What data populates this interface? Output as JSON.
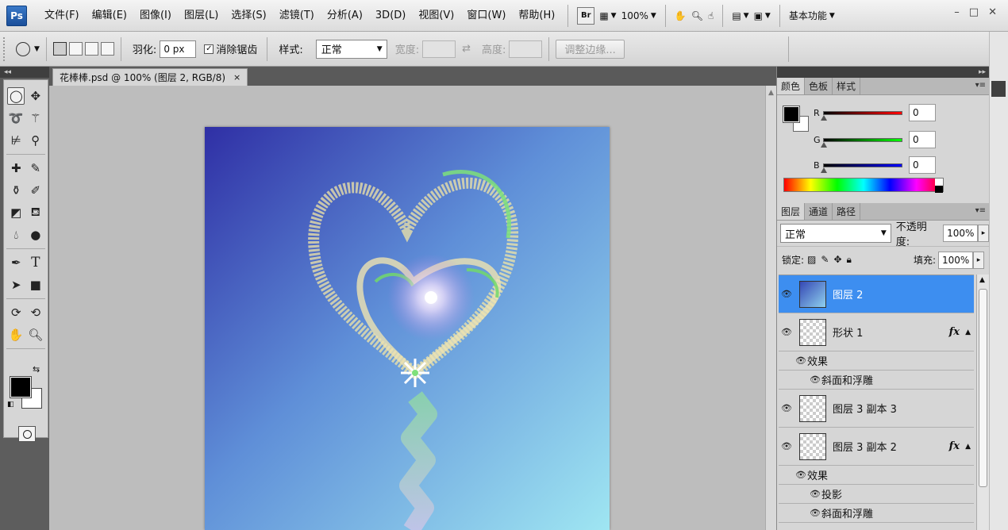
{
  "app": {
    "logo": "Ps",
    "menus": [
      "文件(F)",
      "编辑(E)",
      "图像(I)",
      "图层(L)",
      "选择(S)",
      "滤镜(T)",
      "分析(A)",
      "3D(D)",
      "视图(V)",
      "窗口(W)",
      "帮助(H)"
    ],
    "bridge_label": "Br",
    "zoom": "100%",
    "workspace": "基本功能",
    "window_controls": [
      "–",
      "□",
      "✕"
    ]
  },
  "options": {
    "feather_label": "羽化:",
    "feather_value": "0 px",
    "antialias_label": "消除锯齿",
    "antialias_checked": true,
    "style_label": "样式:",
    "style_value": "正常",
    "width_label": "宽度:",
    "height_label": "高度:",
    "refine_edge_button": "调整边缘..."
  },
  "document": {
    "tab_title": "花棒棒.psd @ 100% (图层 2, RGB/8)",
    "close_glyph": "×"
  },
  "color_panel": {
    "tabs": [
      "颜色",
      "色板",
      "样式"
    ],
    "active_tab": "颜色",
    "channels": [
      {
        "name": "R",
        "value": "0",
        "color": "#ff0000"
      },
      {
        "name": "G",
        "value": "0",
        "color": "#00ff00"
      },
      {
        "name": "B",
        "value": "0",
        "color": "#0000ff"
      }
    ],
    "foreground": "#000000",
    "background": "#ffffff"
  },
  "layers_panel": {
    "tabs": [
      "图层",
      "通道",
      "路径"
    ],
    "active_tab": "图层",
    "blend_mode": "正常",
    "opacity_label": "不透明度:",
    "opacity_value": "100%",
    "lock_label": "锁定:",
    "fill_label": "填充:",
    "fill_value": "100%",
    "layers": [
      {
        "name": "图层 2",
        "selected": true,
        "thumb": "image",
        "fx": false
      },
      {
        "name": "形状 1",
        "selected": false,
        "thumb": "transparent",
        "fx": true,
        "effects_label": "效果",
        "effects": [
          "斜面和浮雕"
        ]
      },
      {
        "name": "图层 3 副本 3",
        "selected": false,
        "thumb": "transparent",
        "fx": false
      },
      {
        "name": "图层 3 副本 2",
        "selected": false,
        "thumb": "transparent",
        "fx": true,
        "effects_label": "效果",
        "effects": [
          "投影",
          "斜面和浮雕"
        ]
      }
    ],
    "fx_glyph": "fx"
  },
  "theme": {
    "selected_layer": "#3d8ef0",
    "canvas_gradient_start": "#3140b0",
    "canvas_gradient_end": "#9be0f0"
  }
}
